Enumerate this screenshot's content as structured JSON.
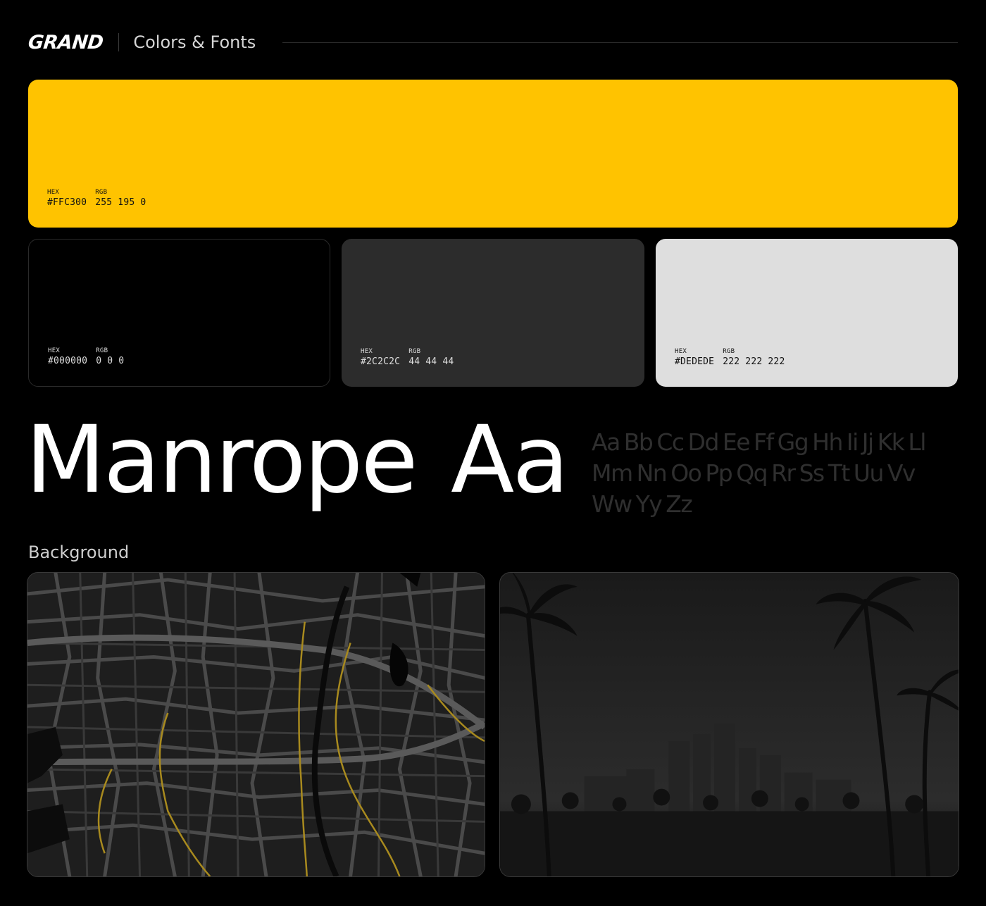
{
  "header": {
    "logo": "GRAND",
    "title": "Colors & Fonts"
  },
  "swatches": [
    {
      "hex_label": "HEX",
      "rgb_label": "RGB",
      "hex": "#FFC300",
      "rgb": "255 195 0"
    },
    {
      "hex_label": "HEX",
      "rgb_label": "RGB",
      "hex": "#000000",
      "rgb": "0 0 0"
    },
    {
      "hex_label": "HEX",
      "rgb_label": "RGB",
      "hex": "#2C2C2C",
      "rgb": "44 44 44"
    },
    {
      "hex_label": "HEX",
      "rgb_label": "RGB",
      "hex": "#DEDEDE",
      "rgb": "222 222 222"
    }
  ],
  "font": {
    "name": "Manrope",
    "sample": "Aa",
    "alphabet": "Aa Bb Cc Dd Ee Ff Gg Hh Ii Jj Kk Ll Mm Nn Oo Pp Qq Rr Ss Tt Uu Vv Ww Yy Zz"
  },
  "background": {
    "label": "Background"
  },
  "colors": {
    "accent": "#FFC300",
    "black": "#000000",
    "dark": "#2C2C2C",
    "light": "#DEDEDE"
  }
}
